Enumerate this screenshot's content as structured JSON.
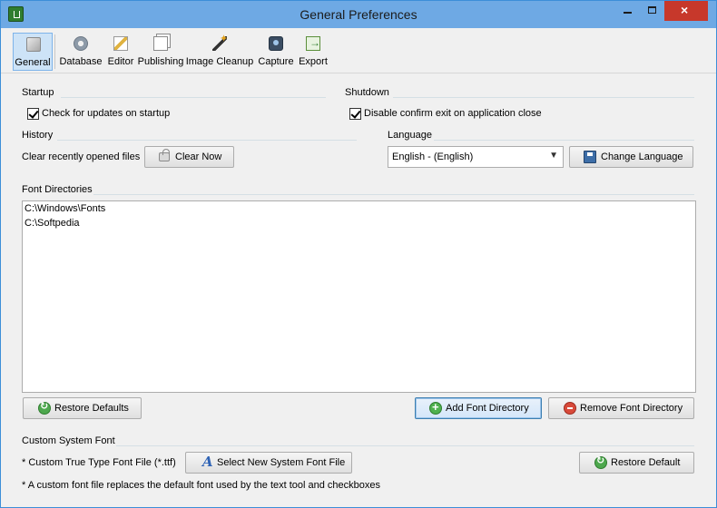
{
  "window": {
    "title": "General Preferences",
    "close_glyph": "×"
  },
  "toolbar": {
    "items": [
      {
        "label": "General",
        "icon": "cube-icon",
        "active": true
      },
      {
        "label": "Database",
        "icon": "database-gear-icon"
      },
      {
        "label": "Editor",
        "icon": "pencil-icon"
      },
      {
        "label": "Publishing",
        "icon": "pages-icon"
      },
      {
        "label": "Image Cleanup",
        "icon": "magic-wand-icon"
      },
      {
        "label": "Capture",
        "icon": "camera-icon"
      },
      {
        "label": "Export",
        "icon": "export-icon"
      }
    ]
  },
  "startup": {
    "label": "Startup",
    "check_updates": {
      "label": "Check for updates on startup",
      "checked": true
    }
  },
  "shutdown": {
    "label": "Shutdown",
    "disable_confirm": {
      "label": "Disable confirm exit on application close",
      "checked": true
    }
  },
  "history": {
    "label": "History",
    "clear_text": "Clear recently opened files",
    "clear_button": "Clear Now"
  },
  "language": {
    "label": "Language",
    "selected": "English - (English)",
    "change_button": "Change Language"
  },
  "font_directories": {
    "label": "Font Directories",
    "items": [
      "C:\\Windows\\Fonts",
      "C:\\Softpedia"
    ],
    "restore_defaults_button": "Restore Defaults",
    "add_button": "Add Font Directory",
    "remove_button": "Remove Font Directory"
  },
  "custom_font": {
    "label": "Custom System Font",
    "file_text": "* Custom True Type Font File (*.ttf)",
    "select_button": "Select New System Font File",
    "restore_default_button": "Restore Default",
    "note": "* A custom font file replaces the default font used by the text tool and checkboxes"
  },
  "colors": {
    "titlebar": "#6ea9e4",
    "close_button": "#c7382b",
    "active_tab": "#cde3f7"
  }
}
